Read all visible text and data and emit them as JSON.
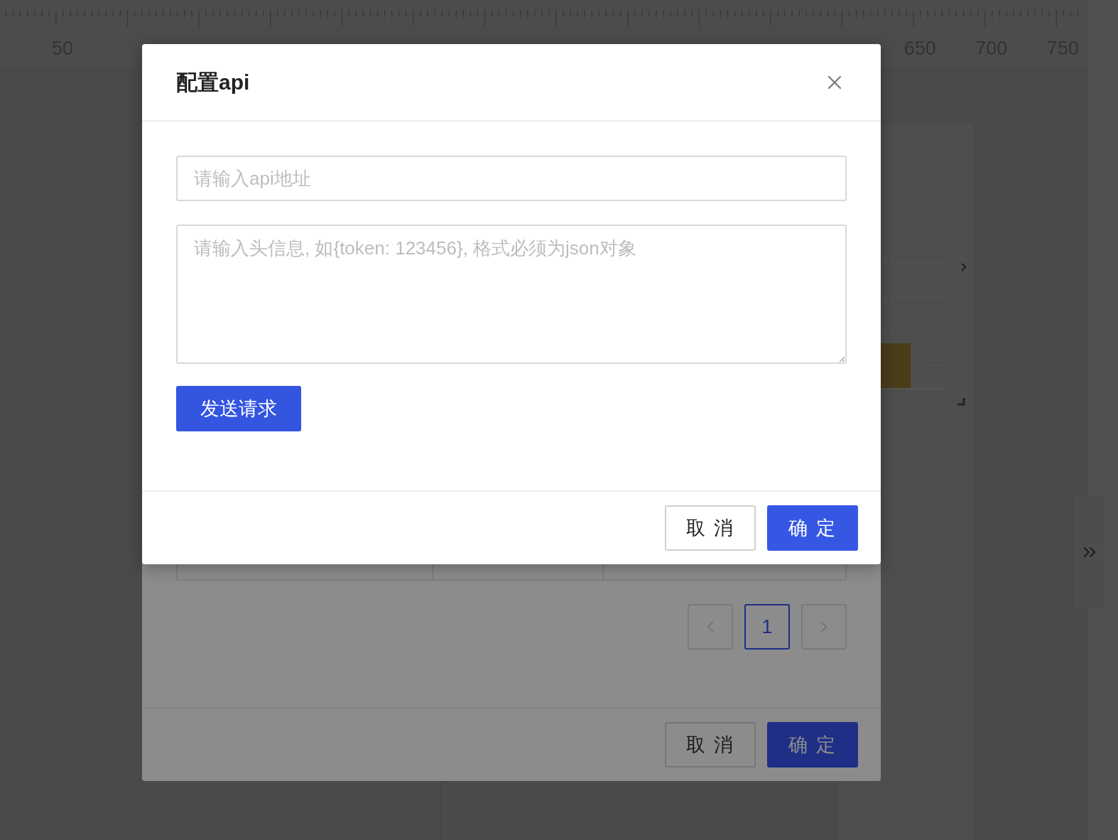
{
  "ruler": {
    "labels": [
      "50",
      "650",
      "700",
      "750"
    ]
  },
  "background_dialog": {
    "pages": [
      {
        "label": "1",
        "selected": true
      }
    ],
    "buttons": [
      {
        "label": "取 消",
        "kind": "default"
      },
      {
        "label": "确 定",
        "kind": "primary"
      }
    ]
  },
  "dialog": {
    "title": "配置api",
    "url_field": {
      "placeholder": "请输入api地址"
    },
    "headers_field": {
      "placeholder": "请输入头信息, 如{token: 123456}, 格式必须为json对象"
    },
    "send_button": "发送请求",
    "buttons": [
      {
        "label": "取 消",
        "kind": "default"
      },
      {
        "label": "确 定",
        "kind": "primary"
      }
    ]
  }
}
